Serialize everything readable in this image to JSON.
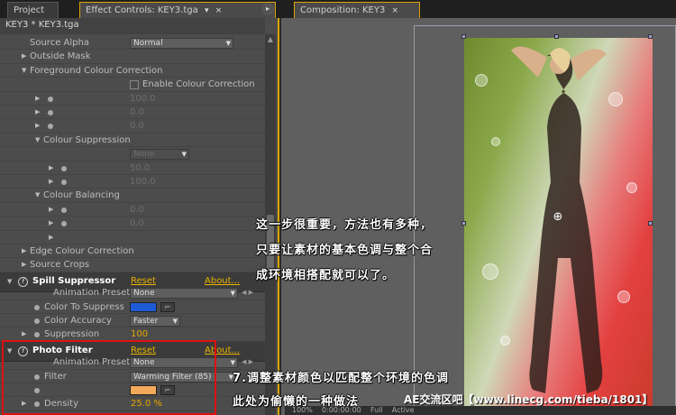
{
  "tabs": {
    "project": "Project",
    "effect_controls": "Effect Controls: KEY3.tga",
    "composition": "Composition: KEY3",
    "close_glyph": "×",
    "menu_glyph": "▾"
  },
  "effect_panel": {
    "header": "KEY3 * KEY3.tga",
    "source_alpha": {
      "label": "Source Alpha",
      "value": "Normal"
    },
    "outside_mask": "Outside Mask",
    "foreground_colour_correction": "Foreground Colour Correction",
    "enable_colour_correction": "Enable Colour Correction",
    "fcc_values": [
      "100.0",
      "0.0",
      "0.0"
    ],
    "colour_suppression": "Colour Suppression",
    "colour_suppression_values": {
      "dropdown": "None",
      "v1": "50.0",
      "v2": "100.0"
    },
    "colour_balancing": "Colour Balancing",
    "colour_balancing_values": [
      "0.0",
      "0.0"
    ],
    "edge_colour_correction": "Edge Colour Correction",
    "source_crops": "Source Crops"
  },
  "spill_suppressor": {
    "title": "Spill Suppressor",
    "reset": "Reset",
    "about": "About...",
    "animation_presets_label": "Animation Presets:",
    "animation_presets_value": "None",
    "color_to_suppress_label": "Color To Suppress",
    "color_to_suppress_hex": "#1e5bd6",
    "color_accuracy_label": "Color Accuracy",
    "color_accuracy_value": "Faster",
    "suppression_label": "Suppression",
    "suppression_value": "100"
  },
  "photo_filter": {
    "title": "Photo Filter",
    "reset": "Reset",
    "about": "About...",
    "animation_presets_label": "Animation Presets:",
    "animation_presets_value": "None",
    "filter_label": "Filter",
    "filter_value": "Warming Filter (85)",
    "color_hex": "#f4a85a",
    "density_label": "Density",
    "density_value": "25.0 %"
  },
  "annotations": {
    "line1": "这一步很重要，方法也有多种，",
    "line2": "只要让素材的基本色调与整个合",
    "line3": "成环境相搭配就可以了。",
    "line4": "7.调整素材颜色以匹配整个环境的色调",
    "line5": "此处为偷懒的一种做法",
    "watermark": "AE交流区吧【www.linecg.com/tieba/1801】"
  },
  "bottom_bar": {
    "zoom": "100%",
    "time": "0:00:00:00",
    "view": "Full",
    "camera": "Active"
  },
  "colors": {
    "accent": "#d9a400",
    "highlight_box": "#e01010",
    "link": "#e8b200"
  }
}
